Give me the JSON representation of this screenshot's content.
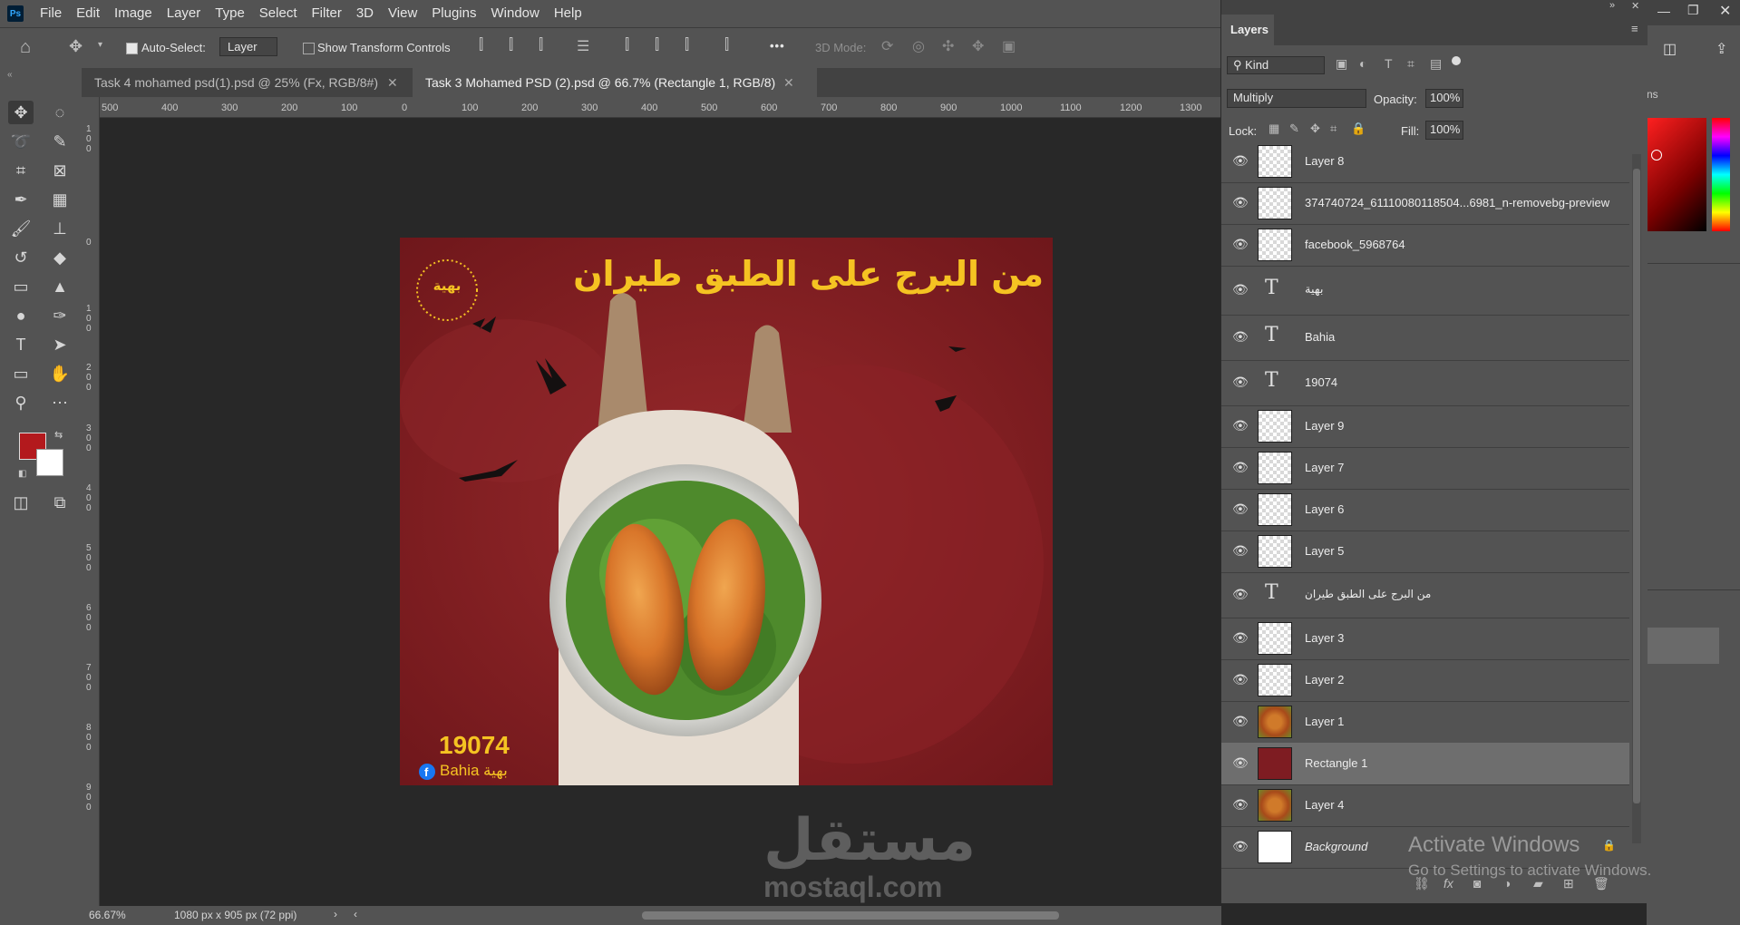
{
  "app": {
    "logo": "Ps"
  },
  "menu": [
    "File",
    "Edit",
    "Image",
    "Layer",
    "Type",
    "Select",
    "Filter",
    "3D",
    "View",
    "Plugins",
    "Window",
    "Help"
  ],
  "options": {
    "auto_select_label": "Auto-Select:",
    "auto_select_value": "Layer",
    "show_transform_label": "Show Transform Controls",
    "mode_3d_label": "3D Mode:",
    "more_icon": "•••"
  },
  "tabs": [
    {
      "label": "Task 4 mohamed psd(1).psd @ 25% (Fx, RGB/8#)"
    },
    {
      "label": "Task 3 Mohamed  PSD (2).psd @ 66.7% (Rectangle 1, RGB/8)"
    }
  ],
  "ruler": {
    "h": [
      "500",
      "400",
      "300",
      "200",
      "100",
      "0",
      "100",
      "200",
      "300",
      "400",
      "500",
      "600",
      "700",
      "800",
      "900",
      "1000",
      "1100",
      "1200",
      "1300"
    ],
    "v": [
      "0",
      "1\n0\n0",
      "0",
      "1\n0\n0",
      "2\n0\n0",
      "3\n0\n0",
      "4\n0\n0",
      "5\n0\n0",
      "6\n0\n0",
      "7\n0\n0",
      "8\n0\n0",
      "9\n0\n0"
    ]
  },
  "status": {
    "zoom": "66.67%",
    "doc_size": "1080 px x 905 px (72 ppi)"
  },
  "document": {
    "headline": "من البرج على الطبق طيران",
    "logo_text": "بهية",
    "phone": "19074",
    "brand_en": "Bahia",
    "brand_ar": "بهية"
  },
  "colors": {
    "foreground": "#b3191d",
    "background": "#ffffff",
    "doc_bg": "#7e1c22",
    "headline": "#f5c322"
  },
  "layers_panel": {
    "title": "Layers",
    "filter_kind": "Kind",
    "blend_mode": "Multiply",
    "opacity_label": "Opacity:",
    "opacity_value": "100%",
    "lock_label": "Lock:",
    "fill_label": "Fill:",
    "fill_value": "100%",
    "layers": [
      {
        "name": "Layer 8",
        "kind": "pixel"
      },
      {
        "name": "374740724_61110080118504...6981_n-removebg-preview",
        "kind": "smart"
      },
      {
        "name": "facebook_5968764",
        "kind": "smart"
      },
      {
        "name": "بهية",
        "kind": "text"
      },
      {
        "name": "Bahia",
        "kind": "text"
      },
      {
        "name": "19074",
        "kind": "text"
      },
      {
        "name": "Layer 9",
        "kind": "pixel"
      },
      {
        "name": "Layer 7",
        "kind": "pixel"
      },
      {
        "name": "Layer 6",
        "kind": "pixel"
      },
      {
        "name": "Layer 5",
        "kind": "pixel"
      },
      {
        "name": "من البرج على الطبق طيران",
        "kind": "text"
      },
      {
        "name": "Layer 3",
        "kind": "pixel"
      },
      {
        "name": "Layer 2",
        "kind": "pixel"
      },
      {
        "name": "Layer 1",
        "kind": "food"
      },
      {
        "name": "Rectangle 1",
        "kind": "rect",
        "selected": true
      },
      {
        "name": "Layer 4",
        "kind": "food"
      },
      {
        "name": "Background",
        "kind": "white",
        "italic": true
      }
    ]
  },
  "right_panel": {
    "tab": "ns"
  },
  "watermarks": {
    "activate_title": "Activate Windows",
    "activate_sub": "Go to Settings to activate Windows.",
    "site_ar": "مستقل",
    "site_en": "mostaql.com"
  }
}
